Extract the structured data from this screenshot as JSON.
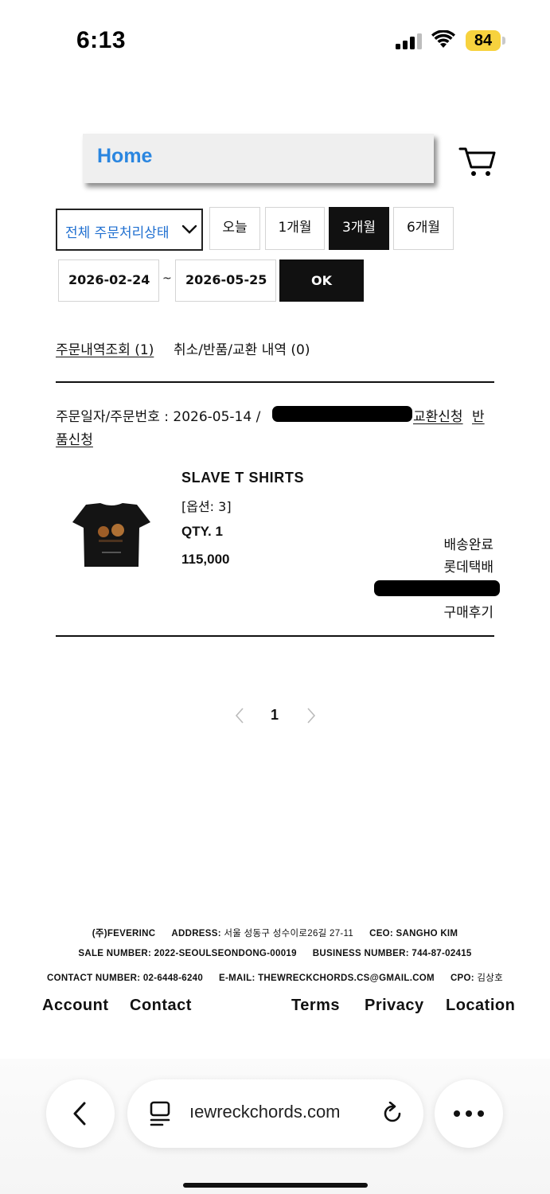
{
  "status_bar": {
    "time": "6:13",
    "battery": "84",
    "battery_color": "#f7d23e"
  },
  "header": {
    "home_label": "Home",
    "home_color": "#2a86e0",
    "cart_icon": "cart-icon"
  },
  "filters": {
    "status_select": "전체 주문처리상태",
    "periods": [
      {
        "label": "오늘",
        "active": false
      },
      {
        "label": "1개월",
        "active": false
      },
      {
        "label": "3개월",
        "active": true
      },
      {
        "label": "6개월",
        "active": false
      }
    ],
    "start_date": "2026-02-24",
    "separator": "~",
    "end_date": "2026-05-25",
    "ok_label": "OK"
  },
  "order_tabs": {
    "history": "주문내역조회 (1)",
    "cancel": "취소/반품/교환 내역 (0)"
  },
  "order": {
    "label": "주문일자/주문번호 : 2026-05-14 /",
    "exchange_link": "교환신청",
    "return_link_part1": "반",
    "return_link_part2": "품신청",
    "product": {
      "name": "SLAVE T SHIRTS",
      "option": "[옵션: 3]",
      "qty": "QTY. 1",
      "price": "115,000"
    },
    "delivery_status": "배송완료",
    "courier": "롯데택배",
    "review_link": "구매후기"
  },
  "pagination": {
    "current_page": "1"
  },
  "footer": {
    "company": "(주)FEVERINC",
    "address_label": "ADDRESS:",
    "address": "서울 성동구 성수이로26길 27-11",
    "ceo_label": "CEO:",
    "ceo": "SANGHO KIM",
    "sale_label": "SALE NUMBER:",
    "sale": "2022-SEOULSEONDONG-00019",
    "business_label": "BUSINESS NUMBER:",
    "business": "744-87-02415",
    "contact_label": "CONTACT NUMBER:",
    "contact": "02-6448-6240",
    "email_label": "E-MAIL:",
    "email": "THEWRECKCHORDS.CS@GMAIL.COM",
    "cpo_label": "CPO:",
    "cpo": "김상호",
    "nav": [
      "Account",
      "Contact",
      "Terms",
      "Privacy",
      "Location"
    ]
  },
  "browser": {
    "url": "ıewreckchords.com"
  }
}
